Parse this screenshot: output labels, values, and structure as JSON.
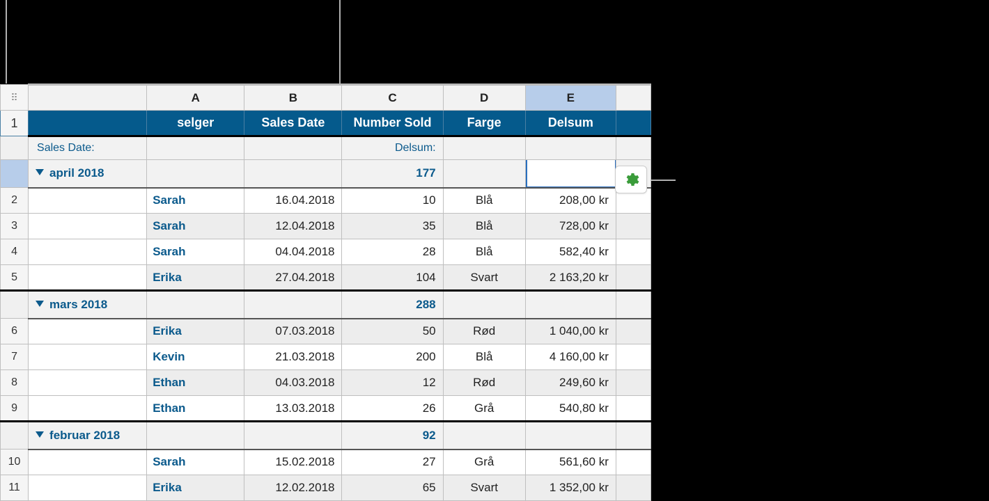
{
  "columns": {
    "A": "A",
    "B": "B",
    "C": "C",
    "D": "D",
    "E": "E"
  },
  "headers": {
    "seller": "selger",
    "salesDate": "Sales Date",
    "numberSold": "Number Sold",
    "color": "Farge",
    "subtotal": "Delsum"
  },
  "categoryLabels": {
    "groupBy": "Sales Date:",
    "subtotal": "Delsum:"
  },
  "groups": [
    {
      "name": "april 2018",
      "subtotal_num": "177",
      "rows": [
        {
          "n": "2",
          "seller": "Sarah",
          "date": "16.04.2018",
          "num": "10",
          "color": "Blå",
          "money": "208,00 kr",
          "alt": false
        },
        {
          "n": "3",
          "seller": "Sarah",
          "date": "12.04.2018",
          "num": "35",
          "color": "Blå",
          "money": "728,00 kr",
          "alt": true
        },
        {
          "n": "4",
          "seller": "Sarah",
          "date": "04.04.2018",
          "num": "28",
          "color": "Blå",
          "money": "582,40 kr",
          "alt": false
        },
        {
          "n": "5",
          "seller": "Erika",
          "date": "27.04.2018",
          "num": "104",
          "color": "Svart",
          "money": "2 163,20 kr",
          "alt": true
        }
      ]
    },
    {
      "name": "mars 2018",
      "subtotal_num": "288",
      "rows": [
        {
          "n": "6",
          "seller": "Erika",
          "date": "07.03.2018",
          "num": "50",
          "color": "Rød",
          "money": "1 040,00 kr",
          "alt": true
        },
        {
          "n": "7",
          "seller": "Kevin",
          "date": "21.03.2018",
          "num": "200",
          "color": "Blå",
          "money": "4 160,00 kr",
          "alt": false
        },
        {
          "n": "8",
          "seller": "Ethan",
          "date": "04.03.2018",
          "num": "12",
          "color": "Rød",
          "money": "249,60 kr",
          "alt": true
        },
        {
          "n": "9",
          "seller": "Ethan",
          "date": "13.03.2018",
          "num": "26",
          "color": "Grå",
          "money": "540,80 kr",
          "alt": false
        }
      ]
    },
    {
      "name": "februar 2018",
      "subtotal_num": "92",
      "rows": [
        {
          "n": "10",
          "seller": "Sarah",
          "date": "15.02.2018",
          "num": "27",
          "color": "Grå",
          "money": "561,60 kr",
          "alt": false
        },
        {
          "n": "11",
          "seller": "Erika",
          "date": "12.02.2018",
          "num": "65",
          "color": "Svart",
          "money": "1 352,00 kr",
          "alt": true
        }
      ]
    }
  ],
  "rowHeaderOne": "1"
}
